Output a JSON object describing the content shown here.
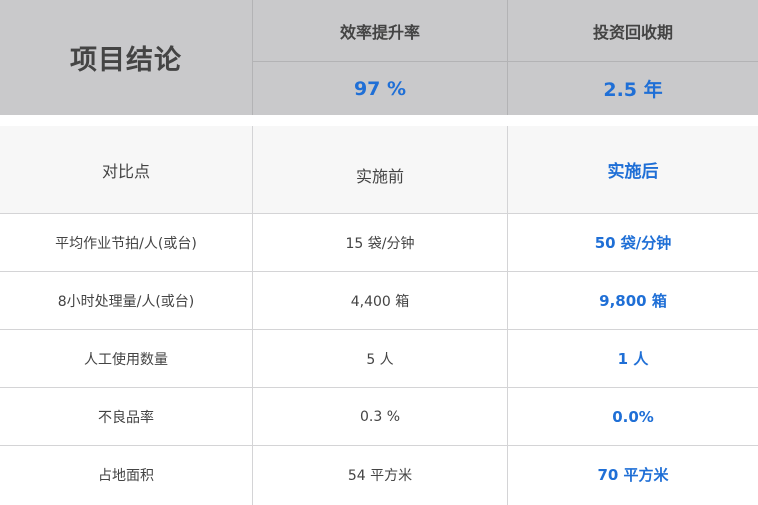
{
  "summary": {
    "title": "项目结论",
    "metrics": [
      {
        "label": "效率提升率",
        "value": "97 %"
      },
      {
        "label": "投资回收期",
        "value": "2.5 年"
      }
    ]
  },
  "comparison": {
    "headers": {
      "point": "对比点",
      "before": "实施前",
      "after": "实施后"
    },
    "rows": [
      {
        "point": "平均作业节拍/人(或台)",
        "before": "15 袋/分钟",
        "after": "50 袋/分钟"
      },
      {
        "point": "8小时处理量/人(或台)",
        "before": "4,400 箱",
        "after": "9,800 箱"
      },
      {
        "point": "人工使用数量",
        "before": "5 人",
        "after": "1 人"
      },
      {
        "point": "不良品率",
        "before": "0.3 %",
        "after": "0.0%"
      },
      {
        "point": "占地面积",
        "before": "54 平方米",
        "after": "70 平方米"
      }
    ]
  },
  "colors": {
    "accent_blue": "#1f6fd6",
    "summary_bg": "#c9c9cb",
    "text_dark": "#444444"
  }
}
